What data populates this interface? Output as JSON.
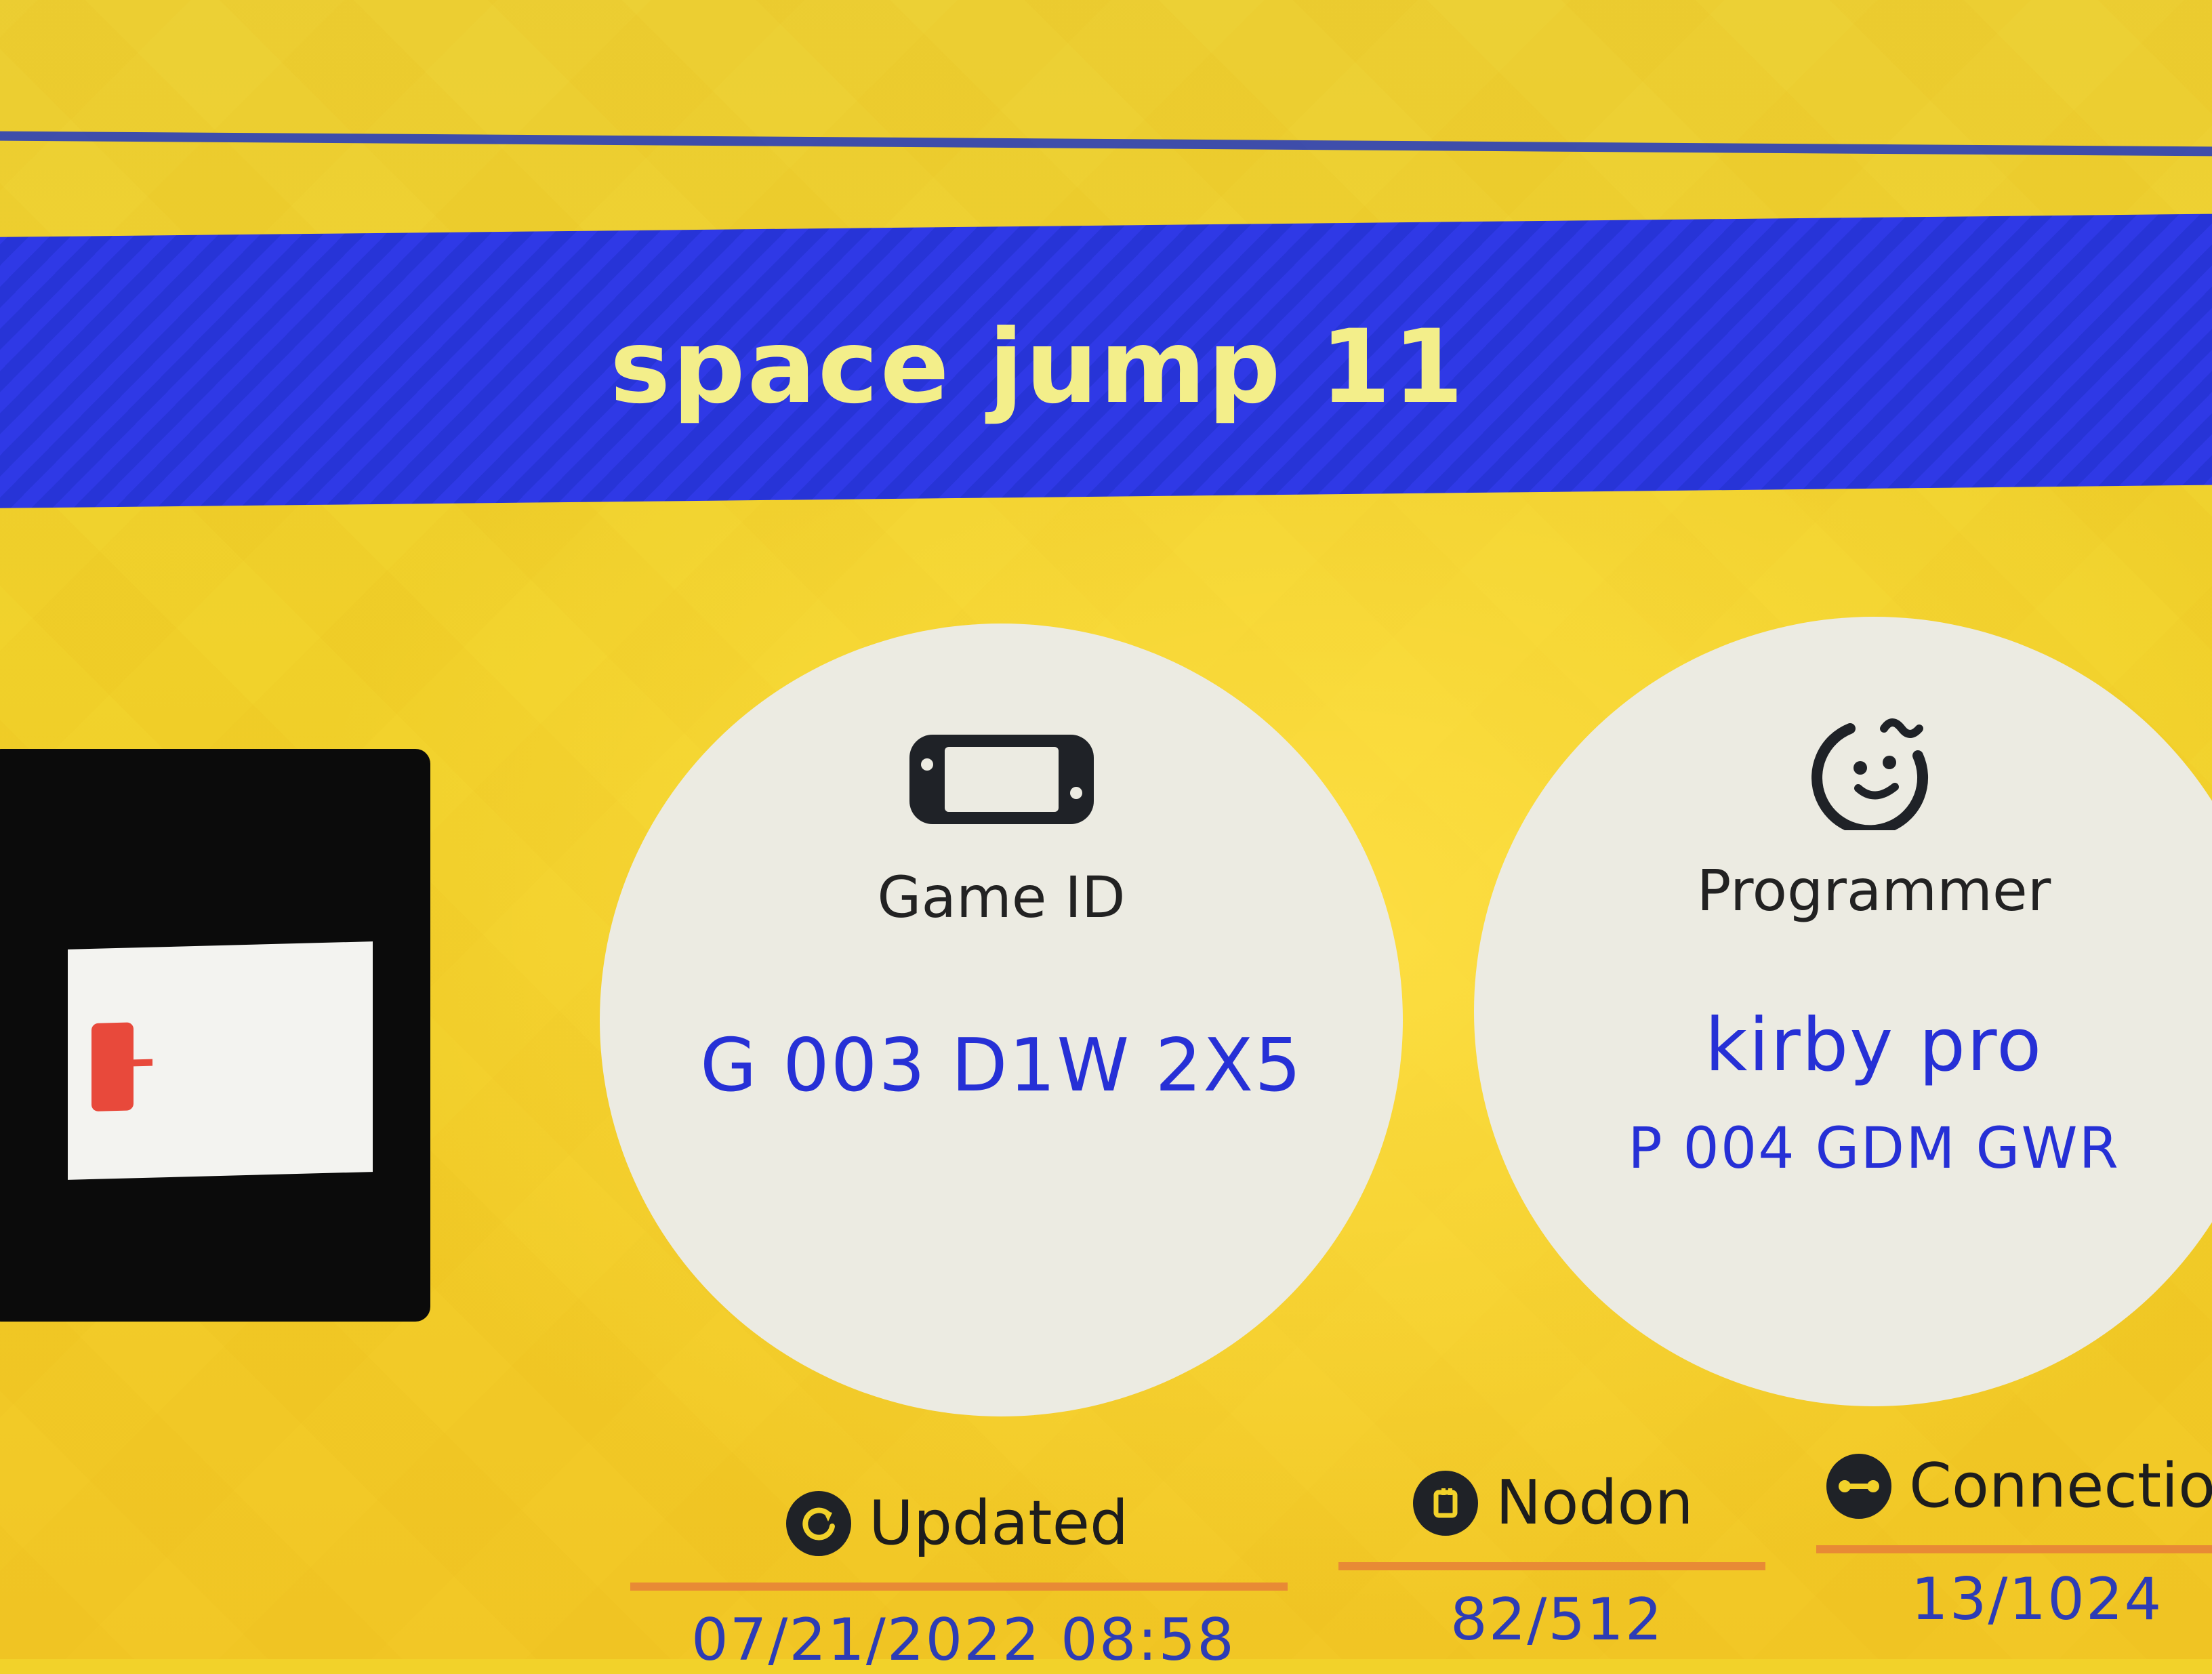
{
  "game": {
    "title": "space jump 11"
  },
  "game_id": {
    "label": "Game ID",
    "value": "G 003 D1W 2X5",
    "icon": "handheld-console-icon"
  },
  "programmer": {
    "label": "Programmer",
    "name": "kirby pro",
    "id": "P 004 GDM GWR",
    "icon": "smiling-face-icon"
  },
  "stats": {
    "updated": {
      "label": "Updated",
      "value": "07/21/2022 08:58",
      "icon": "refresh-icon"
    },
    "nodon": {
      "label": "Nodon",
      "value": "82/512",
      "icon": "nodon-icon"
    },
    "connections": {
      "label": "Connections",
      "value": "13/1024",
      "icon": "connection-icon"
    }
  },
  "colors": {
    "background": "#f2d22a",
    "banner": "#2f39e6",
    "title": "#f3ee8a",
    "value_text": "#2630d6",
    "rule": "#e88a35"
  }
}
